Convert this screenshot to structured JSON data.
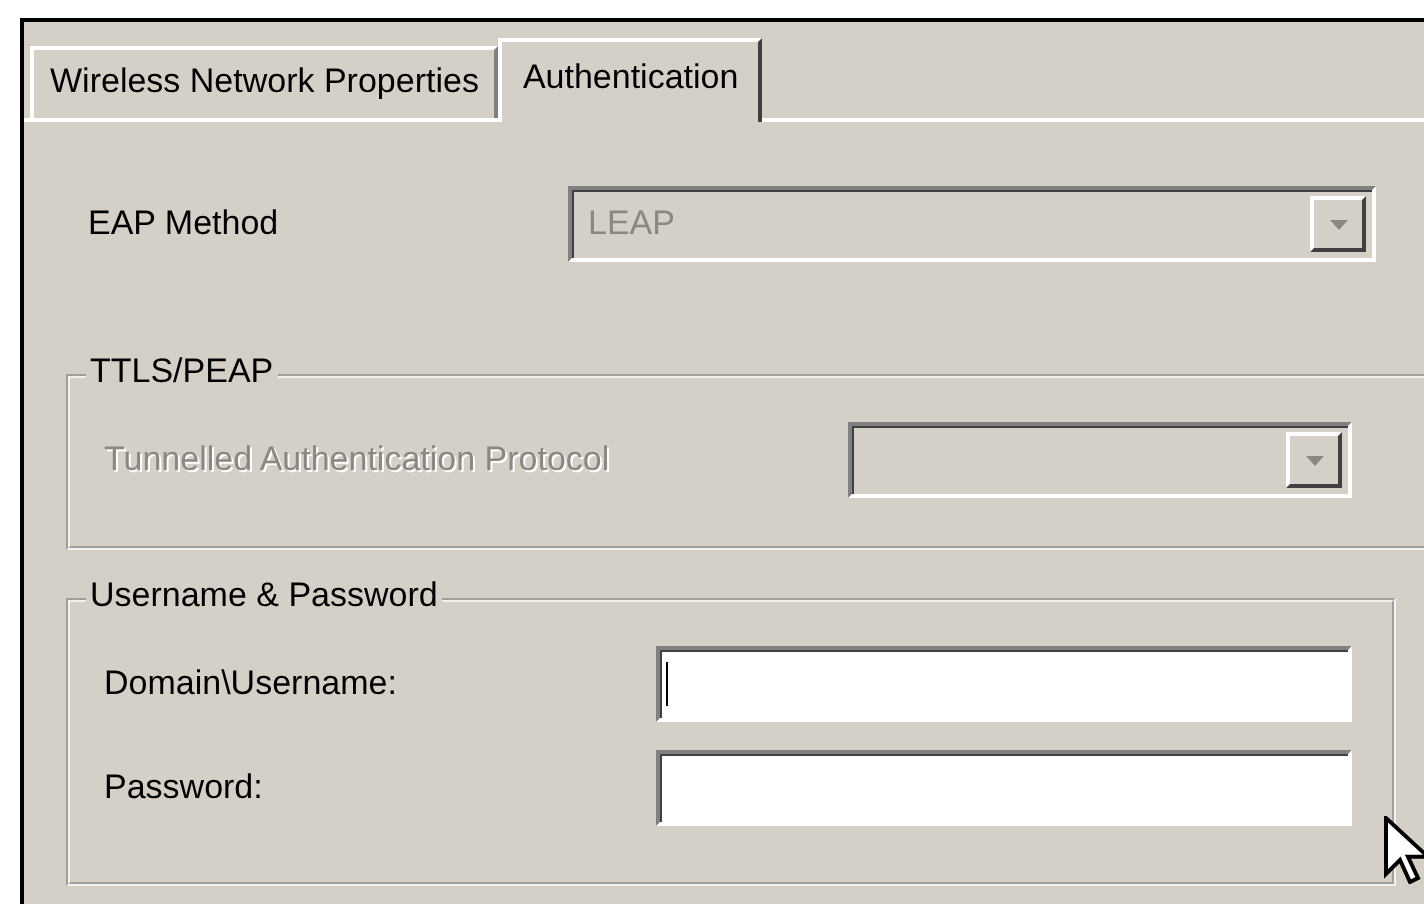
{
  "tabs": [
    {
      "label": "Wireless Network Properties",
      "selected": false
    },
    {
      "label": "Authentication",
      "selected": true
    }
  ],
  "eap_method": {
    "label": "EAP Method",
    "value": "LEAP",
    "disabled": true
  },
  "ttls_peap": {
    "title": "TTLS/PEAP",
    "protocol": {
      "label": "Tunnelled Authentication Protocol",
      "disabled": true
    }
  },
  "credentials": {
    "title": "Username & Password",
    "fields": [
      {
        "label": "Domain\\Username:",
        "focused": true
      },
      {
        "label": "Password:",
        "focused": false
      }
    ]
  }
}
